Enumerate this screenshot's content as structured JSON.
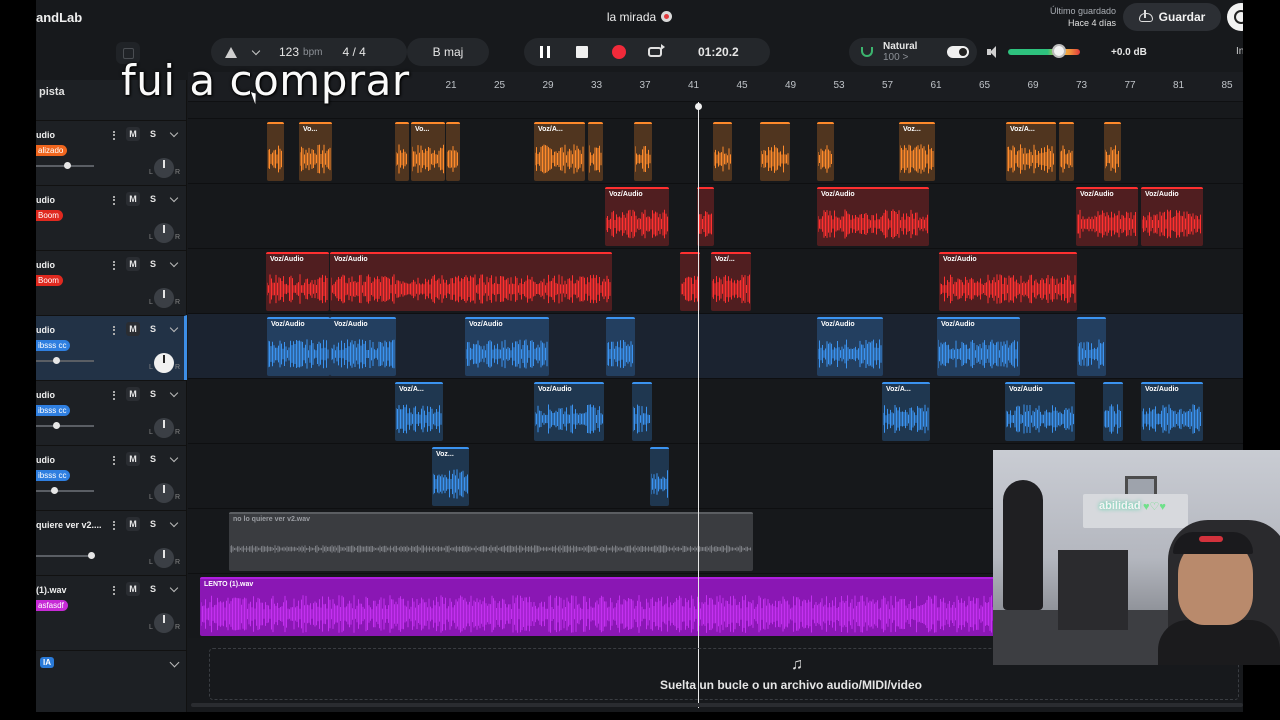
{
  "app": {
    "brand": "andLab",
    "project_title": "la mirada",
    "saved_label": "Último guardado",
    "saved_ago": "Hace 4 días",
    "save_button": "Guardar",
    "edge_button": "In"
  },
  "transport": {
    "bpm": "123",
    "bpm_unit": "bpm",
    "time_signature": "4 / 4",
    "key": "B maj",
    "time": "01:20.2",
    "natural_label": "Natural",
    "natural_sub": "100 >",
    "master_db": "+0.0 dB"
  },
  "sidebar": {
    "add_track": "pista",
    "tracks": [
      {
        "name": "udio",
        "badge": "alizado",
        "badge_color": "#f0661e"
      },
      {
        "name": "udio",
        "badge": "Boom",
        "badge_color": "#e0291f"
      },
      {
        "name": "udio",
        "badge": "Boom",
        "badge_color": "#e0291f"
      },
      {
        "name": "udio",
        "badge": "ibsss cc",
        "badge_color": "#2f7fe0"
      },
      {
        "name": "udio",
        "badge": "ibsss cc",
        "badge_color": "#2f7fe0"
      },
      {
        "name": "udio",
        "badge": "ibsss cc",
        "badge_color": "#2f7fe0"
      },
      {
        "name": "quiere ver v2....",
        "badge": "",
        "badge_color": ""
      },
      {
        "name": "(1).wav",
        "badge": "asfasdf",
        "badge_color": "#c72ad6"
      }
    ],
    "mute_label": "M",
    "solo_label": "S",
    "ai_badge": "IA"
  },
  "ruler": {
    "bars": [
      "21",
      "25",
      "29",
      "33",
      "37",
      "41",
      "45",
      "49",
      "53",
      "57",
      "61",
      "65",
      "69",
      "73",
      "77",
      "81",
      "85"
    ]
  },
  "regions": {
    "vo_short": "Vo...",
    "voz_short": "Voz...",
    "voz_a": "Voz/A...",
    "voz_audio": "Voz/Audio",
    "voz_slash": "Voz/...",
    "gray_clip": "no lo quiere ver v2.wav",
    "purple_clip": "LENTO (1).wav"
  },
  "drop_zone": {
    "text": "Suelta un bucle o un archivo audio/MIDI/video"
  },
  "overlay": {
    "subtitle": "fui a comprar",
    "webcam_sign": "abilidad",
    "webcam_hearts": "♥♡♥"
  },
  "colors": {
    "orange": "#ff8a2b",
    "red": "#ff3030",
    "blue": "#3b93f0",
    "gray": "#5b5e62",
    "purple": "#b01ee0"
  }
}
